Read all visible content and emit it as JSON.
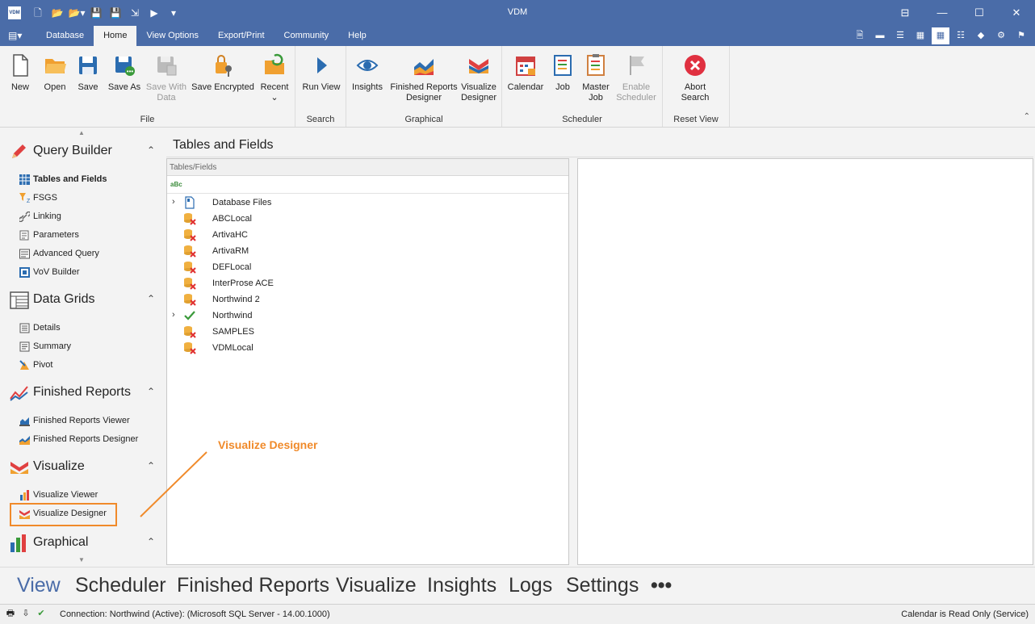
{
  "window": {
    "title": "VDM",
    "app_icon_label": "VDM",
    "controls": [
      "⊟",
      "—",
      "☐",
      "✕"
    ]
  },
  "ribbon_tabs": [
    "Database",
    "Home",
    "View Options",
    "Export/Print",
    "Community",
    "Help"
  ],
  "ribbon": {
    "groups": {
      "file": "File",
      "search": "Search",
      "graphical": "Graphical",
      "scheduler": "Scheduler",
      "reset_view": "Reset View"
    },
    "buttons": {
      "new": "New",
      "open": "Open",
      "save": "Save",
      "save_as": "Save As",
      "save_with_data_1": "Save With",
      "save_with_data_2": "Data",
      "save_encrypted": "Save Encrypted",
      "recent": "Recent",
      "run_view": "Run View",
      "insights": "Insights",
      "frd_1": "Finished Reports",
      "frd_2": "Designer",
      "vd_1": "Visualize",
      "vd_2": "Designer",
      "calendar": "Calendar",
      "job": "Job",
      "master_job_1": "Master",
      "master_job_2": "Job",
      "enable_sched_1": "Enable",
      "enable_sched_2": "Scheduler",
      "abort_1": "Abort",
      "abort_2": "Search"
    }
  },
  "leftnav": {
    "query_builder": {
      "title": "Query Builder",
      "items": [
        "Tables and Fields",
        "FSGS",
        "Linking",
        "Parameters",
        "Advanced Query",
        "VoV Builder"
      ]
    },
    "data_grids": {
      "title": "Data Grids",
      "items": [
        "Details",
        "Summary",
        "Pivot"
      ]
    },
    "finished_reports": {
      "title": "Finished Reports",
      "items": [
        "Finished Reports Viewer",
        "Finished Reports Designer"
      ]
    },
    "visualize": {
      "title": "Visualize",
      "items": [
        "Visualize Viewer",
        "Visualize Designer"
      ]
    },
    "graphical": {
      "title": "Graphical"
    }
  },
  "main": {
    "title": "Tables and Fields",
    "tree_header": "Tables/Fields",
    "filter_icon_label": "aBc",
    "tree_items": [
      {
        "label": "Database Files",
        "expandable": true,
        "icon": "file-icon"
      },
      {
        "label": "ABCLocal",
        "expandable": false,
        "icon": "db-error-icon"
      },
      {
        "label": "ArtivaHC",
        "expandable": false,
        "icon": "db-error-icon"
      },
      {
        "label": "ArtivaRM",
        "expandable": false,
        "icon": "db-error-icon"
      },
      {
        "label": "DEFLocal",
        "expandable": false,
        "icon": "db-error-icon"
      },
      {
        "label": "InterProse ACE",
        "expandable": false,
        "icon": "db-error-icon"
      },
      {
        "label": "Northwind 2",
        "expandable": false,
        "icon": "db-error-icon"
      },
      {
        "label": "Northwind",
        "expandable": true,
        "icon": "check-icon"
      },
      {
        "label": "SAMPLES",
        "expandable": false,
        "icon": "db-error-icon"
      },
      {
        "label": "VDMLocal",
        "expandable": false,
        "icon": "db-error-icon"
      }
    ]
  },
  "annotation": {
    "text": "Visualize Designer",
    "color": "#f08a2a"
  },
  "bottomnav": [
    "View",
    "Scheduler",
    "Finished Reports",
    "Visualize",
    "Insights",
    "Logs",
    "Settings",
    "•••"
  ],
  "statusbar": {
    "connection": "Connection: Northwind (Active): (Microsoft SQL Server - 14.00.1000)",
    "right": "Calendar is Read Only (Service)"
  },
  "colors": {
    "accent": "#4a6ca8",
    "highlight": "#f08a2a"
  }
}
